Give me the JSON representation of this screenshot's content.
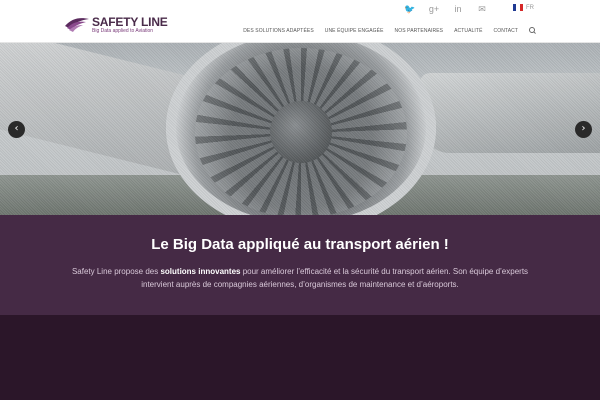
{
  "topbar": {
    "social": [
      {
        "icon": "twitter-icon",
        "glyph": "🐦"
      },
      {
        "icon": "google-plus-icon",
        "glyph": "g+"
      },
      {
        "icon": "linkedin-icon",
        "glyph": "in"
      },
      {
        "icon": "mail-icon",
        "glyph": "✉"
      }
    ],
    "language": "FR"
  },
  "header": {
    "logo_title": "SAFETY LINE",
    "logo_subtitle": "Big Data applied to Aviation",
    "nav": [
      "DES SOLUTIONS ADAPTÉES",
      "UNE ÉQUIPE ENGAGÉE",
      "NOS PARTENAIRES",
      "ACTUALITÉ",
      "CONTACT"
    ]
  },
  "hero": {
    "prev_glyph": "‹",
    "next_glyph": "›"
  },
  "intro": {
    "title": "Le Big Data appliqué au transport aérien !",
    "text_before": "Safety Line propose des ",
    "text_bold": "solutions innovantes",
    "text_after": " pour améliorer l’efficacité et la sécurité du transport aérien. Son équipe d’experts intervient auprès de compagnies aériennes, d’organismes de maintenance et d’aéroports."
  },
  "colors": {
    "brand": "#4a2b4a",
    "intro_bg": "#452a45",
    "bottom_bg": "#2b1629"
  }
}
